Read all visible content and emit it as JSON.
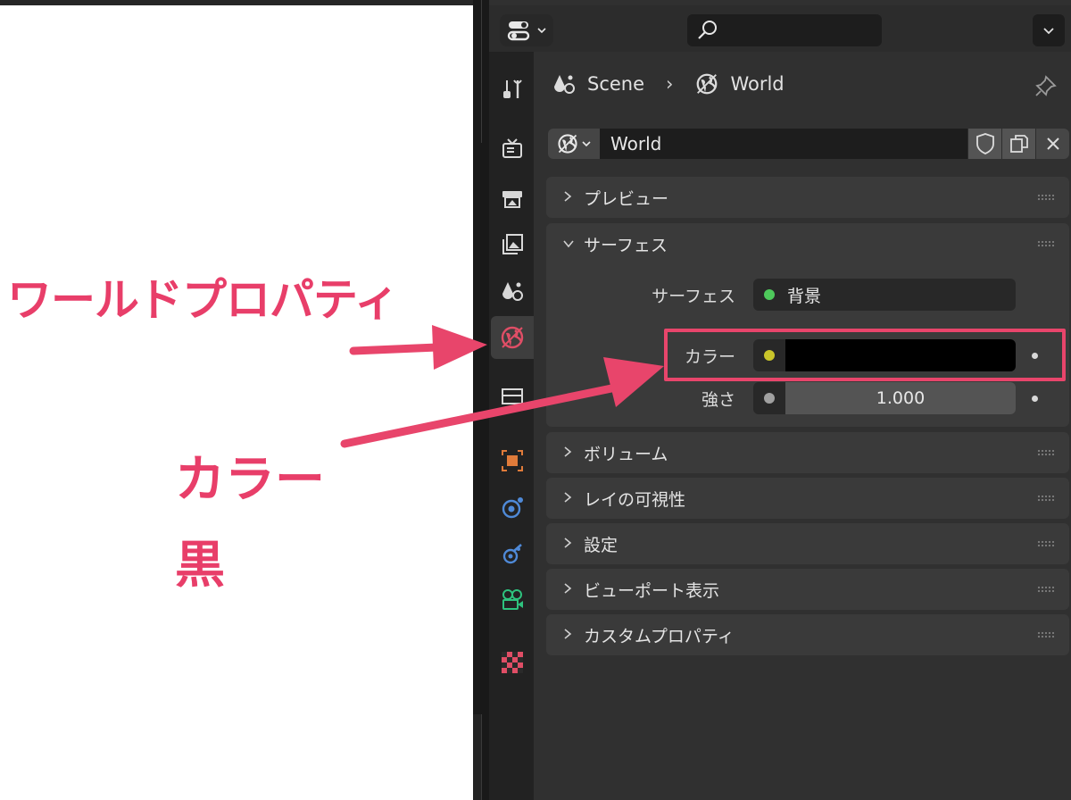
{
  "header": {
    "search_placeholder": ""
  },
  "breadcrumb": {
    "scene": "Scene",
    "separator": "›",
    "world": "World"
  },
  "datablock": {
    "name": "World"
  },
  "sections": {
    "preview": "プレビュー",
    "surface": "サーフェス",
    "volume": "ボリューム",
    "ray_visibility": "レイの可視性",
    "settings": "設定",
    "viewport_display": "ビューポート表示",
    "custom_properties": "カスタムプロパティ"
  },
  "surface_props": {
    "surface_label": "サーフェス",
    "surface_value": "背景",
    "color_label": "カラー",
    "color_value": "#000000",
    "strength_label": "強さ",
    "strength_value": "1.000"
  },
  "annotations": {
    "world_properties": "ワールドプロパティ",
    "color": "カラー",
    "black": "黒"
  },
  "colors": {
    "annotation": "#e83e69",
    "surface_socket": "#4ec95b",
    "color_socket": "#c9c52a",
    "strength_socket": "#a0a0a0",
    "active_tab_world": "#e04e66",
    "panel_bg": "#303030"
  },
  "tabs": [
    "tool-icon",
    "render-icon",
    "output-icon",
    "view-layer-icon",
    "scene-icon",
    "world-icon",
    "collection-icon",
    "object-icon",
    "physics-icon",
    "constraints-icon",
    "data-icon",
    "texture-icon"
  ]
}
